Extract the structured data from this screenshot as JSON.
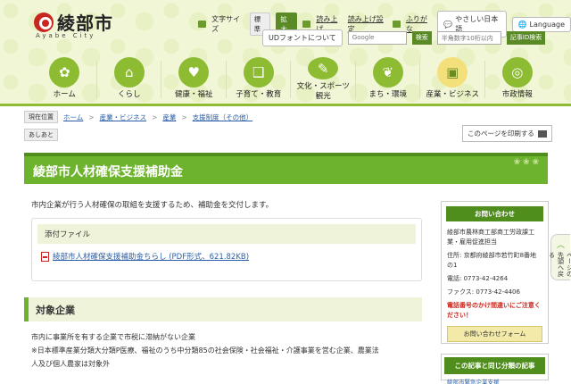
{
  "header": {
    "logo_title": "綾部市",
    "logo_sub": "Ayabe City",
    "font_size_label": "文字サイズ",
    "font_standard": "標準",
    "font_large": "拡大",
    "read_aloud": "読み上げ",
    "read_aloud_settings": "読み上げ設定",
    "furigana": "ふりがな",
    "easy_japanese": "やさしい日本語",
    "language": "Language",
    "ud_font": "UDフォントについて",
    "google_placeholder": "Google",
    "google_btn": "検索",
    "page_id_placeholder": "半角数字10桁以内",
    "page_id_btn": "記事ID検索"
  },
  "nav": {
    "items": [
      {
        "label": "ホーム",
        "icon": "flower-icon",
        "glyph": "✿"
      },
      {
        "label": "くらし",
        "icon": "house-icon",
        "glyph": "⌂"
      },
      {
        "label": "健康・福祉",
        "icon": "heart-hands-icon",
        "glyph": "♥"
      },
      {
        "label": "子育て・教育",
        "icon": "book-icon",
        "glyph": "❑"
      },
      {
        "label": "文化・スポーツ\n観光",
        "icon": "pen-icon",
        "glyph": "✎"
      },
      {
        "label": "まち・環境",
        "icon": "leaf-icon",
        "glyph": "❦"
      },
      {
        "label": "産業・ビジネス",
        "icon": "briefcase-icon",
        "glyph": "▣"
      },
      {
        "label": "市政情報",
        "icon": "city-icon",
        "glyph": "◎"
      }
    ],
    "active_index": 6
  },
  "breadcrumb": {
    "current_label": "現在位置",
    "items": [
      "ホーム",
      "産業・ビジネス",
      "産業",
      "支援制度（その他）"
    ],
    "history_label": "あしあと"
  },
  "print_label": "このページを印刷する",
  "page_title": "綾部市人材確保支援補助金",
  "lead": "市内企業が行う人材確保の取組を支援するため、補助金を交付します。",
  "attachments": {
    "header": "添付ファイル",
    "link": "綾部市人材確保支援補助金ちらし (PDF形式、621.82KB)"
  },
  "section": {
    "heading": "対象企業",
    "lines": [
      "市内に事業所を有する企業で市税に滞納がない企業",
      "※日本標準産業分類大分類P医療、福祉のうち中分類85の社会保険・社会福祉・介護事業を営む企業、農業法",
      "人及び個人農家は対象外"
    ]
  },
  "sidebar": {
    "contact_header": "お問い合わせ",
    "dept": "綾部市農林商工部商工労政課工業・雇用促進担当",
    "address": "住所: 京都府綾部市若竹町8番地の1",
    "phone": "電話: 0773-42-4264",
    "fax": "ファクス: 0773-42-4406",
    "warning": "電話番号のかけ間違いにご注意ください！",
    "form_btn": "お問い合わせフォーム",
    "related_header": "この記事と同じ分類の記事",
    "related_item": "綾部市緊急企業支援"
  },
  "pagetop": {
    "arrow": "︿",
    "label": "ページの先頭へ戻る"
  },
  "colors": {
    "accent": "#6db32e",
    "accent_dark": "#4f8d1c",
    "brand_red": "#c8261e"
  }
}
